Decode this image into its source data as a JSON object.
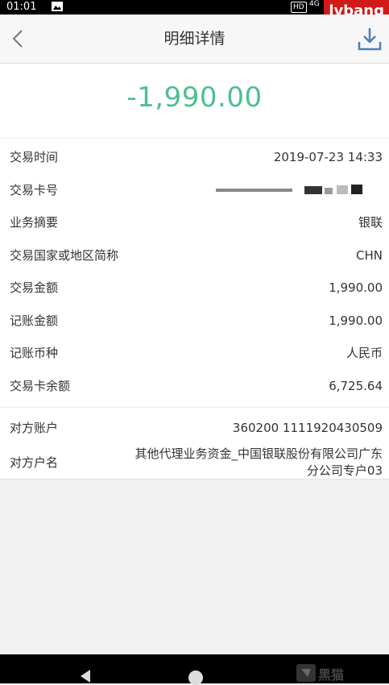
{
  "status_bar": {
    "time": "01:01",
    "hd": "HD",
    "network": "4G",
    "watermark": "lvbang"
  },
  "header": {
    "title": "明细详情",
    "back_icon": "chevron-left-icon",
    "download_icon": "download-icon"
  },
  "amount": "-1,990.00",
  "colors": {
    "amount": "#4cbf8f",
    "background": "#f1f1f1"
  },
  "details": [
    {
      "label": "交易时间",
      "value": "2019-07-23 14:33"
    },
    {
      "label": "交易卡号",
      "value": ""
    },
    {
      "label": "业务摘要",
      "value": "银联"
    },
    {
      "label": "交易国家或地区简称",
      "value": "CHN"
    },
    {
      "label": "交易金额",
      "value": "1,990.00"
    },
    {
      "label": "记账金额",
      "value": "1,990.00"
    },
    {
      "label": "记账币种",
      "value": "人民币"
    },
    {
      "label": "交易卡余额",
      "value": "6,725.64"
    }
  ],
  "counterparty": [
    {
      "label": "对方账户",
      "value": "360200 1111920430509"
    },
    {
      "label": "对方户名",
      "value": "其他代理业务资金_中国银联股份有限公司广东分公司专户03"
    }
  ],
  "nav_bar": {
    "back_icon": "triangle-back-icon",
    "home_icon": "circle-home-icon",
    "logo_text": "黑猫"
  }
}
